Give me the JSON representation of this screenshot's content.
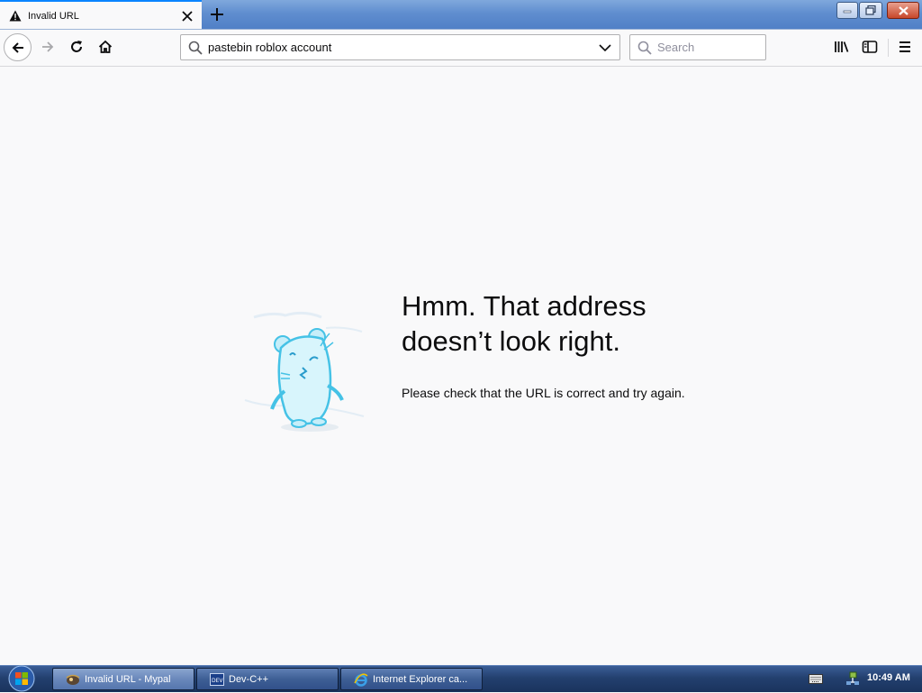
{
  "browser": {
    "tab": {
      "title": "Invalid URL"
    },
    "urlbar": {
      "value": "pastebin roblox account"
    },
    "searchbar": {
      "placeholder": "Search"
    }
  },
  "error_page": {
    "title_line1": "Hmm. That address",
    "title_line2": "doesn’t look right.",
    "description": "Please check that the URL is correct and try again."
  },
  "taskbar": {
    "items": [
      {
        "label": "Invalid URL - Mypal",
        "icon": "mypal-browser-icon",
        "active": true
      },
      {
        "label": "Dev-C++",
        "icon": "devcpp-icon",
        "active": false
      },
      {
        "label": "Internet Explorer ca...",
        "icon": "internet-explorer-icon",
        "active": false
      }
    ],
    "clock": "10:49 AM"
  },
  "colors": {
    "accent": "#0a84ff",
    "page_bg": "#f9f9fa",
    "titlebar": "#5f8dcf",
    "taskbar": "#23406f"
  }
}
